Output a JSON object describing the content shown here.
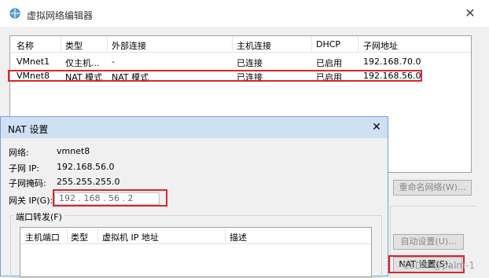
{
  "main_window": {
    "title": "虚拟网络编辑器",
    "close_glyph": "✕"
  },
  "network_table": {
    "columns": [
      "名称",
      "类型",
      "外部连接",
      "主机连接",
      "DHCP",
      "子网地址"
    ],
    "rows": [
      [
        "VMnet1",
        "仅主机...",
        "-",
        "已连接",
        "已启用",
        "192.168.70.0"
      ],
      [
        "VMnet8",
        "NAT 模式",
        "NAT 模式",
        "已连接",
        "已启用",
        "192.168.56.0"
      ]
    ]
  },
  "buttons": {
    "rename": "重命名网络(W)...",
    "auto": "自动设置(U)...",
    "nat": "NAT 设置(S)..."
  },
  "nat_dialog": {
    "title": "NAT 设置",
    "close_glyph": "✕",
    "network_label": "网络:",
    "network_value": "vmnet8",
    "subnet_ip_label": "子网 IP:",
    "subnet_ip_value": "192.168.56.0",
    "subnet_mask_label": "子网掩码:",
    "subnet_mask_value": "255.255.255.0",
    "gateway_label": "网关 IP(G):",
    "gateway_value": "192 . 168 . 56 . 2",
    "port_forward_label": "端口转发(F)",
    "pf_columns": [
      "主机端口",
      "类型",
      "虚拟机 IP 地址",
      "描述"
    ]
  },
  "watermark": "CSDN @palm-1",
  "colors": {
    "highlight_outline": "#d9262e",
    "dialog_titlebar": "#cfe0f4"
  }
}
